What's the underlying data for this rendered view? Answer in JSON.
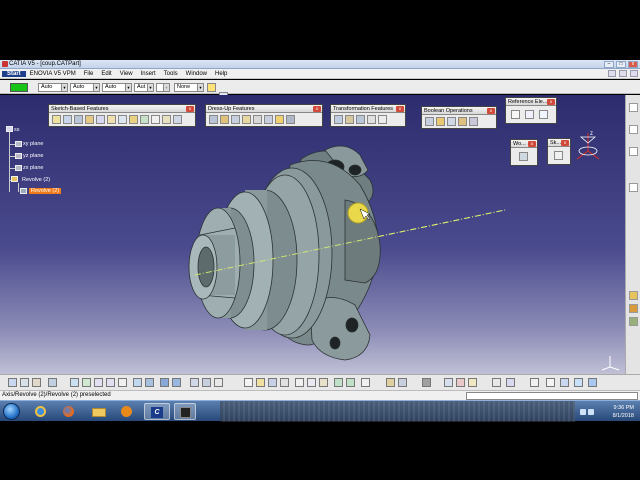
{
  "window": {
    "title": "CATIA V5 - [coup.CATPart]"
  },
  "menu": {
    "items": [
      "Start",
      "ENOVIA V5 VPM",
      "File",
      "Edit",
      "View",
      "Insert",
      "Tools",
      "Window",
      "Help"
    ]
  },
  "graphic_properties": {
    "color": "#18c418",
    "fields": [
      "Auto",
      "Auto",
      "Auto",
      "Aut",
      "None"
    ]
  },
  "toolbars": {
    "sketch_based": "Sketch-Based Features",
    "dress_up": "Dress-Up Features",
    "transformation": "Transformation Features",
    "boolean": "Boolean Operations",
    "reference": "Reference Ele...",
    "workbench": "Wo...",
    "sketcher": "Sk..."
  },
  "tree": {
    "root": "ss",
    "nodes": [
      "xy plane",
      "yz plane",
      "zx plane",
      "Revolve (2)"
    ],
    "selected": "Revolve (2)"
  },
  "status": {
    "text": "Axis/Revolve (2)/Revolve (2) preselected"
  },
  "taskbar": {
    "time": "9:36 PM",
    "date": "8/1/2018"
  },
  "compass_label": "z",
  "icons": [
    "application-icon",
    "start-orb-icon",
    "ie-icon",
    "firefox-icon",
    "folder-icon",
    "media-icon",
    "catia-icon",
    "shutdown-icon"
  ]
}
